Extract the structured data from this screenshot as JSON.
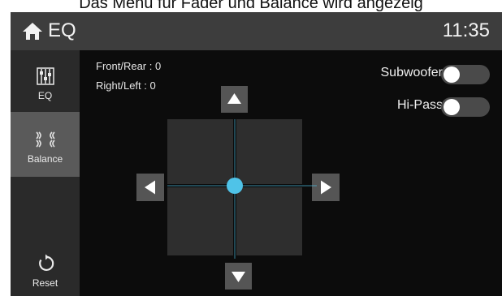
{
  "caption": "Das Menü für Fader und Balance wird angezeig",
  "header": {
    "title": "EQ",
    "time": "11:35"
  },
  "sidebar": {
    "items": [
      {
        "label": "EQ",
        "icon": "eq-sliders-icon"
      },
      {
        "label": "Balance",
        "icon": "balance-speakers-icon",
        "active": true
      },
      {
        "label": "Reset",
        "icon": "reset-icon"
      }
    ]
  },
  "main": {
    "front_rear": "Front/Rear : 0",
    "right_left": "Right/Left : 0",
    "toggles": [
      {
        "label": "Subwoofer",
        "state": "off"
      },
      {
        "label": "Hi-Pass",
        "state": "off"
      }
    ],
    "pad": {
      "front_rear_value": 0,
      "right_left_value": 0
    }
  },
  "colors": {
    "accent": "#4fc3e8",
    "topbar": "#3d3d3d",
    "sidebar_active": "#5a5a5a",
    "main_bg": "#0c0c0c"
  }
}
